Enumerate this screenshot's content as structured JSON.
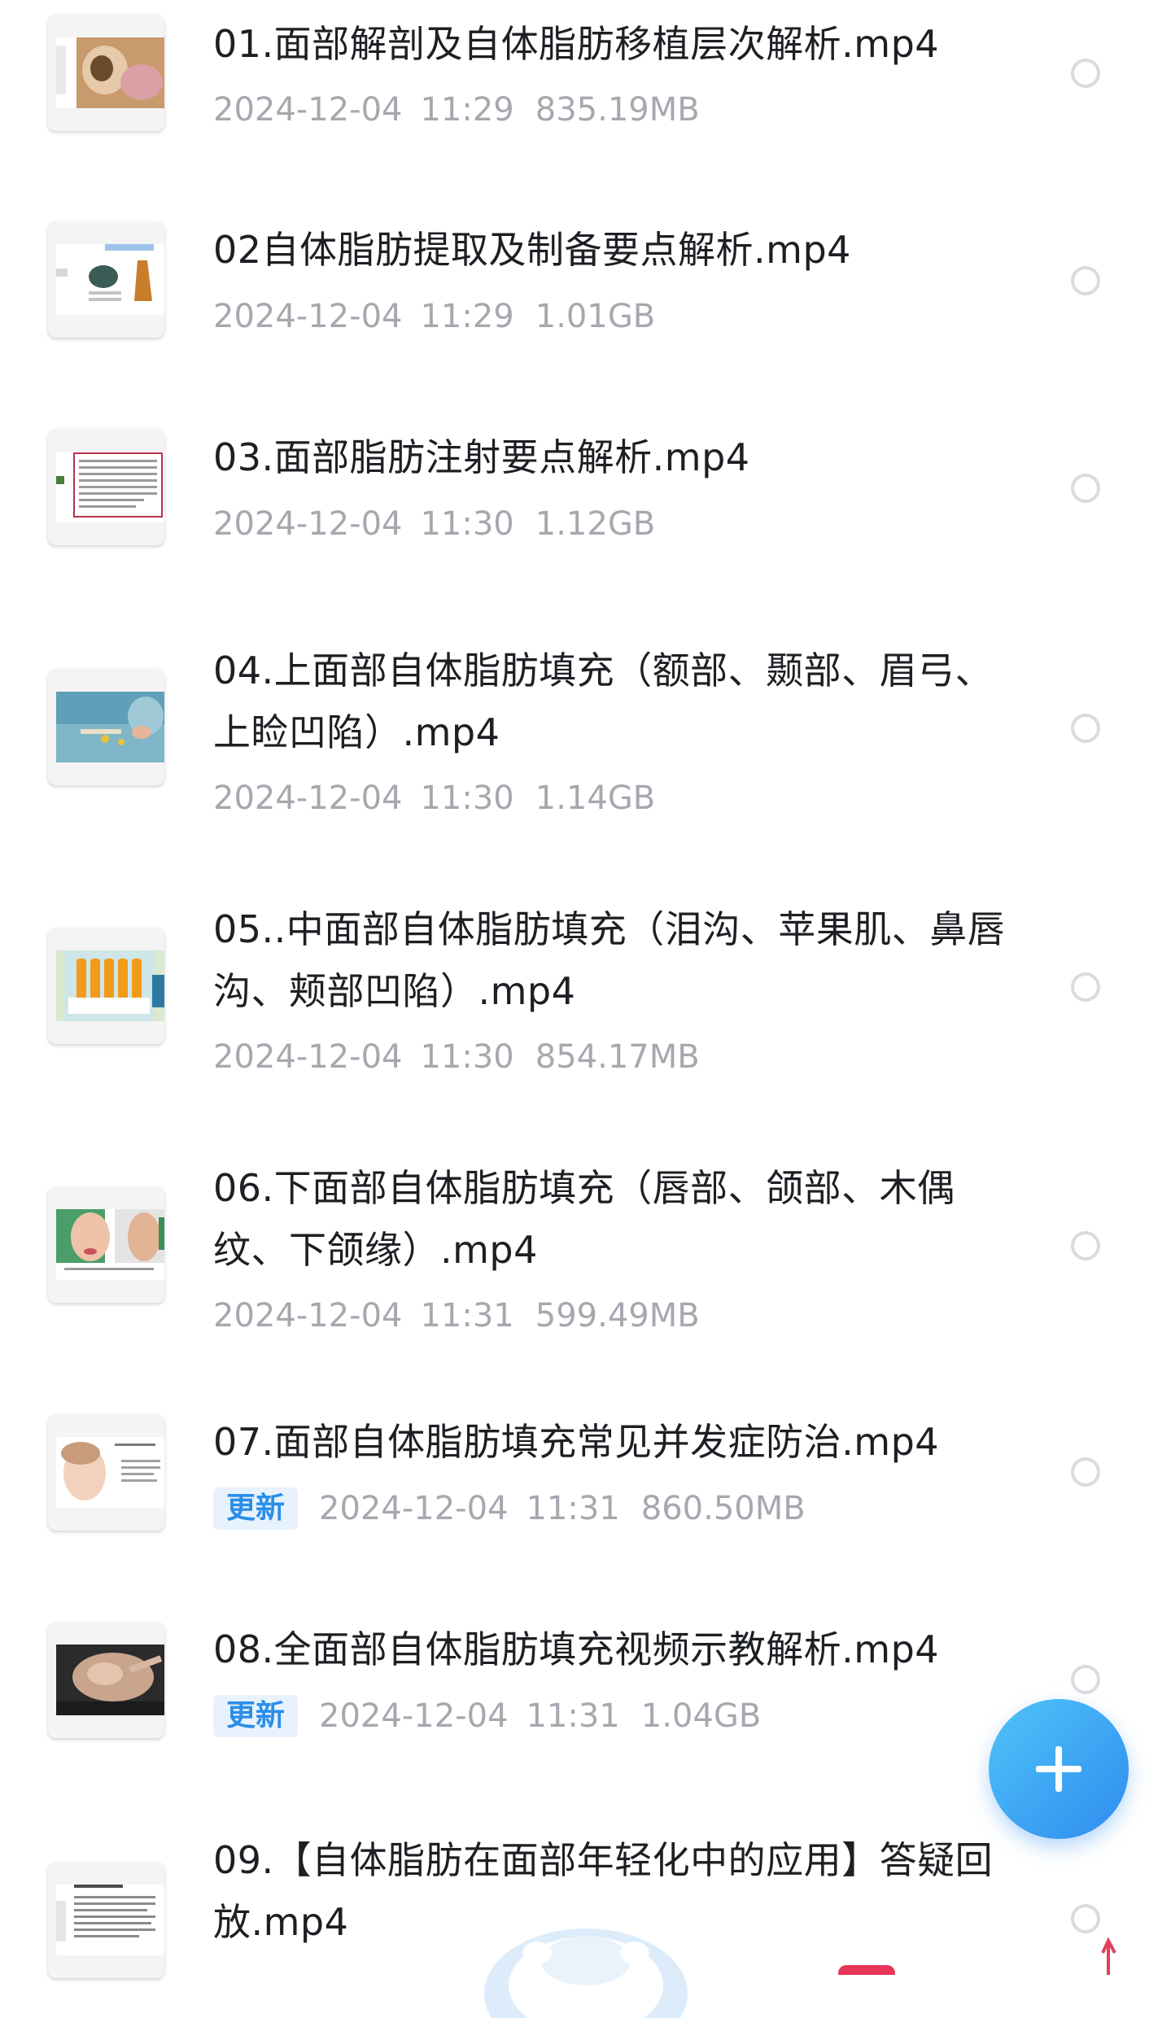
{
  "files": [
    {
      "title": "01.面部解剖及自体脂肪移植层次解析.mp4",
      "date": "2024-12-04",
      "time": "11:29",
      "size": "835.19MB",
      "updated": false
    },
    {
      "title": "02自体脂肪提取及制备要点解析.mp4",
      "date": "2024-12-04",
      "time": "11:29",
      "size": "1.01GB",
      "updated": false
    },
    {
      "title": "03.面部脂肪注射要点解析.mp4",
      "date": "2024-12-04",
      "time": "11:30",
      "size": "1.12GB",
      "updated": false
    },
    {
      "title": "04.上面部自体脂肪填充（额部、颞部、眉弓、上睑凹陷）.mp4",
      "date": "2024-12-04",
      "time": "11:30",
      "size": "1.14GB",
      "updated": false
    },
    {
      "title": "05..中面部自体脂肪填充（泪沟、苹果肌、鼻唇沟、颊部凹陷）.mp4",
      "date": "2024-12-04",
      "time": "11:30",
      "size": "854.17MB",
      "updated": false
    },
    {
      "title": "06.下面部自体脂肪填充（唇部、颌部、木偶纹、下颌缘）.mp4",
      "date": "2024-12-04",
      "time": "11:31",
      "size": "599.49MB",
      "updated": false
    },
    {
      "title": "07.面部自体脂肪填充常见并发症防治.mp4",
      "date": "2024-12-04",
      "time": "11:31",
      "size": "860.50MB",
      "updated": true
    },
    {
      "title": "08.全面部自体脂肪填充视频示教解析.mp4",
      "date": "2024-12-04",
      "time": "11:31",
      "size": "1.04GB",
      "updated": true
    },
    {
      "title": "09.【自体脂肪在面部年轻化中的应用】答疑回放.mp4",
      "date": "",
      "time": "",
      "size": "",
      "updated": false
    }
  ],
  "labels": {
    "update_badge": "更新"
  },
  "icons": {
    "fab": "plus-icon",
    "selector": "radio-circle-icon"
  },
  "colors": {
    "accent": "#2f8cf0",
    "badge_bg": "#e8f2fd",
    "badge_text": "#2a8ee8",
    "title_text": "#1c1f23",
    "meta_text": "#a5a8af"
  }
}
